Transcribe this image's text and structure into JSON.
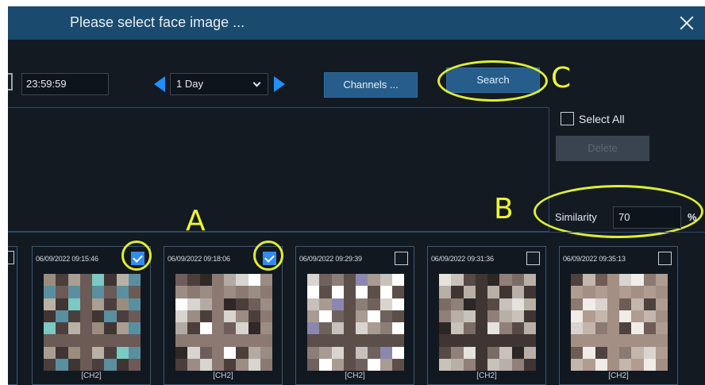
{
  "dialog": {
    "title": "Please select face image ..."
  },
  "toolbar": {
    "end_time": "23:59:59",
    "period": "1 Day",
    "channels_label": "Channels ...",
    "search_label": "Search"
  },
  "side": {
    "select_all_label": "Select All",
    "delete_label": "Delete",
    "similarity_label": "Similarity",
    "similarity_value": "70",
    "similarity_unit": "%"
  },
  "annotations": {
    "a": "A",
    "b": "B",
    "c": "C"
  },
  "results": [
    {
      "timestamp": "06/09/2022 09:15:46",
      "channel": "[CH2]",
      "checked": true
    },
    {
      "timestamp": "06/09/2022 09:18:06",
      "channel": "[CH2]",
      "checked": true
    },
    {
      "timestamp": "06/09/2022 09:29:39",
      "channel": "[CH2]",
      "checked": false
    },
    {
      "timestamp": "06/09/2022 09:31:36",
      "channel": "[CH2]",
      "checked": false
    },
    {
      "timestamp": "06/09/2022 09:35:13",
      "channel": "[CH2]",
      "checked": false
    }
  ],
  "colors": {
    "titlebar": "#1a4a6e",
    "button": "#265d8b",
    "accent_arrow": "#1e90ff",
    "annotation": "#dfee31",
    "checkbox_checked": "#2f8cf0"
  },
  "icons": {
    "close": "close-icon",
    "prev": "arrow-left-icon",
    "next": "arrow-right-icon",
    "dropdown": "chevron-down-icon",
    "date": "calendar-icon"
  }
}
